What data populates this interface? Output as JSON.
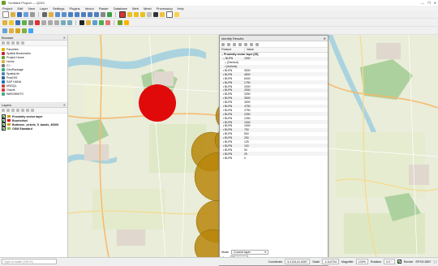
{
  "window": {
    "title": "*Untitled Project — QGIS",
    "controls": [
      "—",
      "❐",
      "✕"
    ]
  },
  "menu": [
    "Project",
    "Edit",
    "View",
    "Layer",
    "Settings",
    "Plugins",
    "Vector",
    "Raster",
    "Database",
    "Web",
    "Mesh",
    "Processing",
    "Help"
  ],
  "browser": {
    "title": "Browser",
    "items": [
      {
        "label": "Favorites",
        "icon": "star-icon",
        "color": "#e4b400"
      },
      {
        "label": "Spatial Bookmarks",
        "icon": "bookmark-icon",
        "color": "#c23"
      },
      {
        "label": "Project Home",
        "icon": "home-icon",
        "color": "#6a9f2a"
      },
      {
        "label": "Home",
        "icon": "folder-icon",
        "color": "#e0b040"
      },
      {
        "label": "C:\\",
        "icon": "drive-icon",
        "color": "#777"
      },
      {
        "label": "GeoPackage",
        "icon": "geopackage-icon",
        "color": "#3a7"
      },
      {
        "label": "SpatiaLite",
        "icon": "spatialite-icon",
        "color": "#58a"
      },
      {
        "label": "PostGIS",
        "icon": "postgis-icon",
        "color": "#336699"
      },
      {
        "label": "SAP HANA",
        "icon": "hana-icon",
        "color": "#1a6fc4"
      },
      {
        "label": "MSSQL",
        "icon": "mssql-icon",
        "color": "#c44"
      },
      {
        "label": "Oracle",
        "icon": "oracle-icon",
        "color": "#d33"
      },
      {
        "label": "WMS/WMTS",
        "icon": "wms-icon",
        "color": "#4a8"
      }
    ]
  },
  "layers": {
    "title": "Layers",
    "items": [
      {
        "label": "Proximity vector layer",
        "color": "#c99a1a",
        "bold": true
      },
      {
        "label": "Buurtcirkel",
        "color": "#e01010",
        "bold": true
      },
      {
        "label": "Buitenen_cirkels_5_bands_40000",
        "color": "#d4a017",
        "bold": true
      },
      {
        "label": "OSM Standard",
        "color": "#8bc34a",
        "bold": true
      }
    ]
  },
  "identify": {
    "title": "Identify Results",
    "columns": [
      "Feature",
      "Value"
    ],
    "rows": [
      {
        "f": "Proximity vector layer [25]",
        "v": "",
        "level": 0,
        "open": true,
        "bold": true
      },
      {
        "f": "BUFN",
        "v": "1500",
        "level": 1,
        "open": true
      },
      {
        "f": "(Derived)",
        "v": "",
        "level": 2,
        "open": true
      },
      {
        "f": "(Actions)",
        "v": "",
        "level": 2,
        "open": false
      },
      {
        "f": "BUFN",
        "v": "3000",
        "level": 1
      },
      {
        "f": "BUFN",
        "v": "4500",
        "level": 1
      },
      {
        "f": "BUFN",
        "v": "6000",
        "level": 1
      },
      {
        "f": "BUFN",
        "v": "1750",
        "level": 1
      },
      {
        "f": "BUFN",
        "v": "2000",
        "level": 1
      },
      {
        "f": "BUFN",
        "v": "2500",
        "level": 1
      },
      {
        "f": "BUFN",
        "v": "3250",
        "level": 1
      },
      {
        "f": "BUFN",
        "v": "3500",
        "level": 1
      },
      {
        "f": "BUFN",
        "v": "4000",
        "level": 1
      },
      {
        "f": "BUFN",
        "v": "4750",
        "level": 1
      },
      {
        "f": "BUFN",
        "v": "2750",
        "level": 1
      },
      {
        "f": "BUFN",
        "v": "2250",
        "level": 1
      },
      {
        "f": "BUFN",
        "v": "1250",
        "level": 1
      },
      {
        "f": "BUFN",
        "v": "1000",
        "level": 1
      },
      {
        "f": "BUFN",
        "v": "1500",
        "level": 1
      },
      {
        "f": "BUFN",
        "v": "750",
        "level": 1
      },
      {
        "f": "BUFN",
        "v": "500",
        "level": 1
      },
      {
        "f": "BUFN",
        "v": "250",
        "level": 1
      },
      {
        "f": "BUFN",
        "v": "125",
        "level": 1
      },
      {
        "f": "BUFN",
        "v": "100",
        "level": 1
      },
      {
        "f": "BUFN",
        "v": "50",
        "level": 1
      },
      {
        "f": "BUFN",
        "v": "25",
        "level": 1
      },
      {
        "f": "BUFN",
        "v": "0",
        "level": 1
      }
    ],
    "mode_label": "Mode",
    "mode_value": "Current layer",
    "view_label": "View",
    "view_value": "Tree"
  },
  "status": {
    "locate_placeholder": "Type to locate (Ctrl+K)",
    "coordinate_label": "Coordinate",
    "coordinate": "5.2134,51.8267",
    "scale_label": "Scale",
    "scale": "1:110704",
    "magnifier_label": "Magnifier",
    "magnifier": "100%",
    "rotation_label": "Rotation",
    "rotation": "0.0 °",
    "render_label": "Render",
    "crs": "EPSG:3857"
  },
  "map": {
    "buffer_fill": "#e00a0a",
    "ring_fill": "#b8860b"
  }
}
